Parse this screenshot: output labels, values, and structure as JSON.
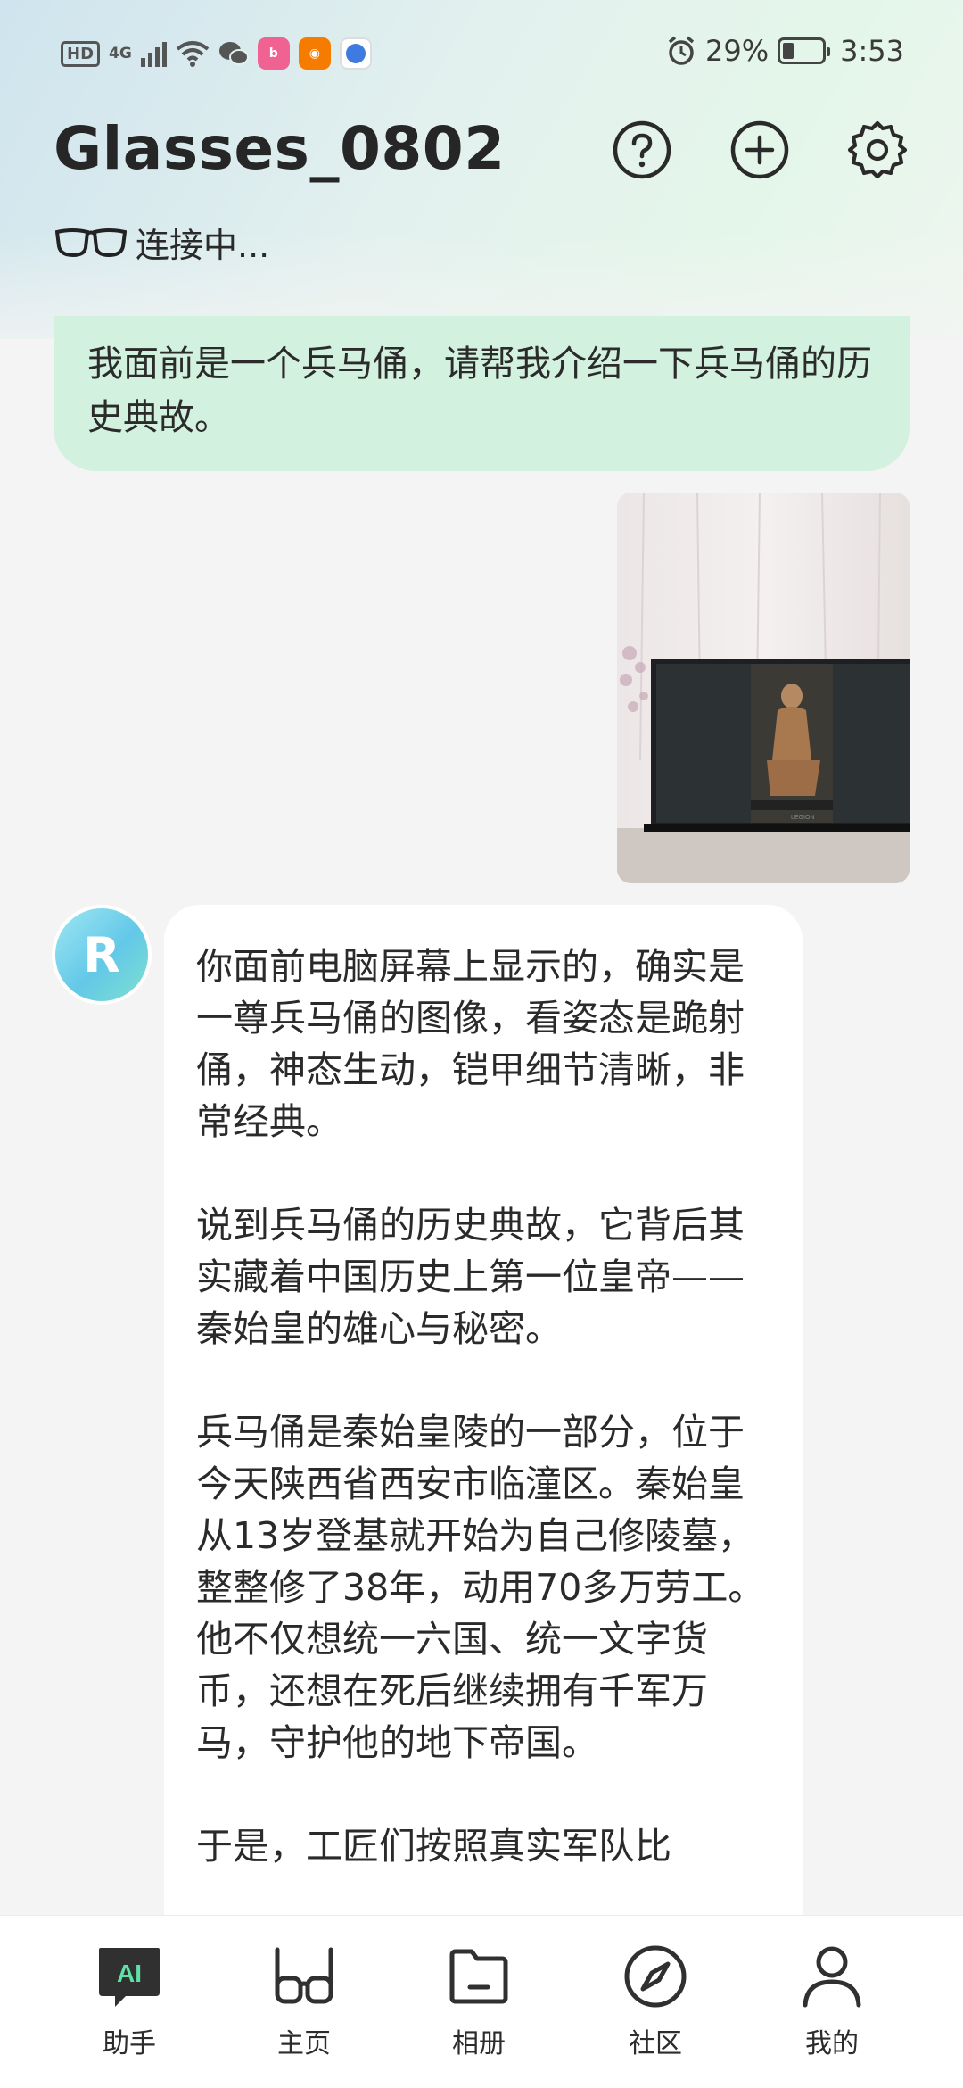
{
  "status_bar": {
    "network": "4G",
    "battery": "29%",
    "battery_level": 0.29,
    "time": "3:53"
  },
  "header": {
    "title": "Glasses_0802",
    "connection_status": "连接中..."
  },
  "chat": {
    "user_message": "我面前是一个兵马俑，请帮我介绍一下兵马俑的历史典故。",
    "ai_paragraphs": [
      "你面前电脑屏幕上显示的，确实是一尊兵马俑的图像，看姿态是跪射俑，神态生动，铠甲细节清晰，非常经典。",
      "说到兵马俑的历史典故，它背后其实藏着中国历史上第一位皇帝——秦始皇的雄心与秘密。",
      "兵马俑是秦始皇陵的一部分，位于今天陕西省西安市临潼区。秦始皇从13岁登基就开始为自己修陵墓，整整修了38年，动用70多万劳工。他不仅想统一六国、统一文字货币，还想在死后继续拥有千军万马，守护他的地下帝国。",
      "于是，工匠们按照真实军队比"
    ],
    "avatar_letter": "R"
  },
  "bottom_nav": {
    "items": [
      {
        "label": "助手",
        "icon": "ai-assistant-icon",
        "badge": "AI"
      },
      {
        "label": "主页",
        "icon": "glasses-icon"
      },
      {
        "label": "相册",
        "icon": "folder-icon"
      },
      {
        "label": "社区",
        "icon": "compass-icon"
      },
      {
        "label": "我的",
        "icon": "person-icon"
      }
    ]
  },
  "colors": {
    "user_bubble": "#d3f1df",
    "ai_bubble": "#ffffff",
    "accent_icon": "#333333"
  }
}
